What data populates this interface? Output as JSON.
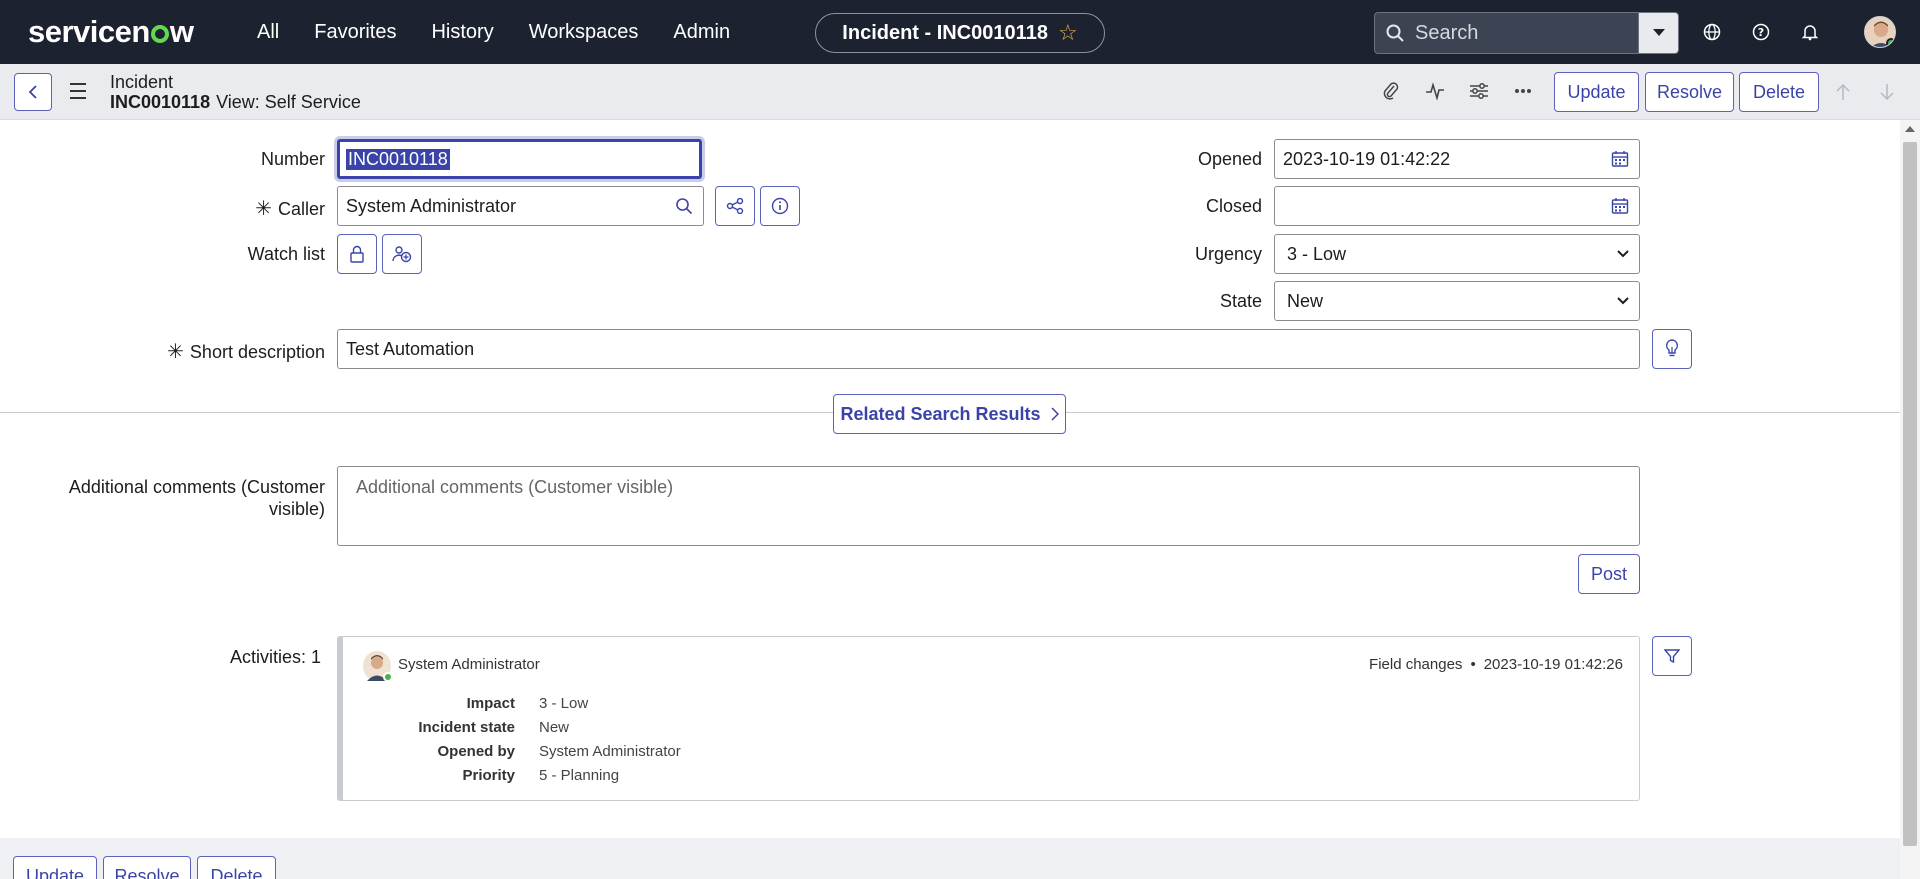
{
  "topnav": {
    "logo": "servicenow",
    "links": [
      "All",
      "Favorites",
      "History",
      "Workspaces",
      "Admin"
    ],
    "record_pill": "Incident - INC0010118",
    "search_placeholder": "Search",
    "icons": [
      "globe-icon",
      "help-icon",
      "bell-icon"
    ]
  },
  "formbar": {
    "record_type": "Incident",
    "record_number": "INC0010118",
    "view_label": "View: Self Service",
    "buttons": {
      "update": "Update",
      "resolve": "Resolve",
      "delete": "Delete"
    }
  },
  "form": {
    "number": {
      "label": "Number",
      "value": "INC0010118"
    },
    "caller": {
      "label": "Caller",
      "value": "System Administrator"
    },
    "watch_list": {
      "label": "Watch list"
    },
    "opened": {
      "label": "Opened",
      "value": "2023-10-19 01:42:22"
    },
    "closed": {
      "label": "Closed",
      "value": ""
    },
    "urgency": {
      "label": "Urgency",
      "value": "3 - Low"
    },
    "state": {
      "label": "State",
      "value": "New"
    },
    "short_description": {
      "label": "Short description",
      "value": "Test Automation"
    },
    "related_search": "Related Search Results",
    "comments": {
      "label_line1": "Additional comments (Customer",
      "label_line2": "visible)",
      "placeholder": "Additional comments (Customer visible)",
      "post": "Post"
    }
  },
  "activity": {
    "label": "Activities: 1",
    "user": "System Administrator",
    "type": "Field changes",
    "timestamp": "2023-10-19 01:42:26",
    "rows": [
      {
        "k": "Impact",
        "v": "3 - Low"
      },
      {
        "k": "Incident state",
        "v": "New"
      },
      {
        "k": "Opened by",
        "v": "System Administrator"
      },
      {
        "k": "Priority",
        "v": "5 - Planning"
      }
    ]
  },
  "bottom_buttons": {
    "update": "Update",
    "resolve": "Resolve",
    "delete": "Delete"
  },
  "colors": {
    "nav_bg": "#1c2230",
    "accent": "#3a44a8",
    "logo_green": "#62d84e"
  }
}
